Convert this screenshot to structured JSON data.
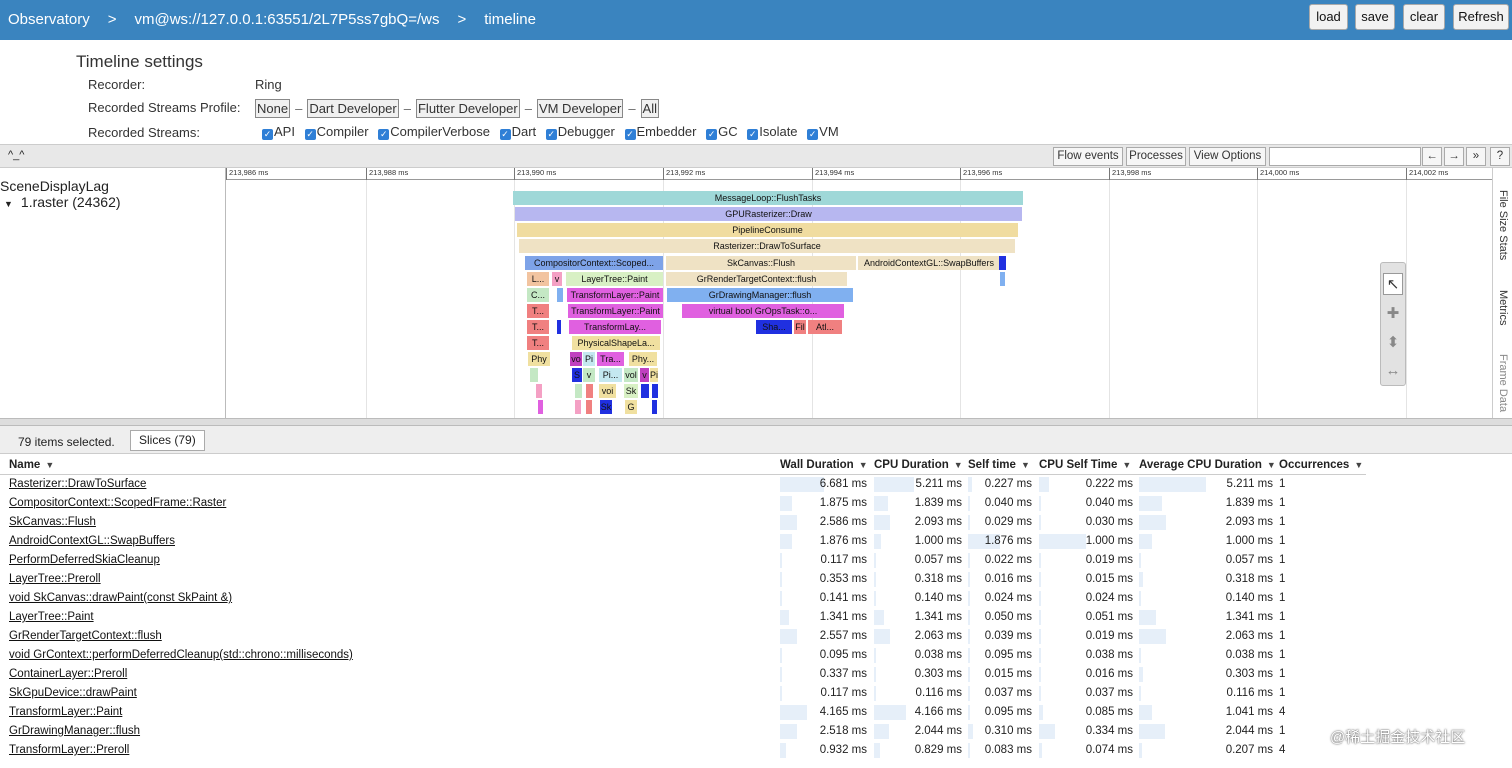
{
  "breadcrumb": [
    "Observatory",
    "vm@ws://127.0.0.1:63551/2L7P5ss7gbQ=/ws",
    "timeline"
  ],
  "breadcrumb_sep": ">",
  "top_buttons": [
    "load",
    "save",
    "clear",
    "Refresh"
  ],
  "settings": {
    "title": "Timeline settings",
    "recorder_label": "Recorder:",
    "recorder_value": "Ring",
    "profile_label": "Recorded Streams Profile:",
    "profiles": [
      "None",
      "Dart Developer",
      "Flutter Developer",
      "VM Developer",
      "All"
    ],
    "profile_sep": "–",
    "streams_label": "Recorded Streams:",
    "streams": [
      "API",
      "Compiler",
      "CompilerVerbose",
      "Dart",
      "Debugger",
      "Embedder",
      "GC",
      "Isolate",
      "VM"
    ],
    "checkmark": "✓"
  },
  "trace_toolbar": {
    "collapse": "^_^",
    "buttons": [
      "Flow events",
      "Processes",
      "View Options"
    ],
    "nav": [
      "←",
      "→",
      "»",
      "?"
    ]
  },
  "track": {
    "process": "SceneDisplayLag",
    "thread": "1.raster (24362)",
    "expand_icon": "▼"
  },
  "ruler_ticks": [
    "213,986 ms",
    "213,988 ms",
    "213,990 ms",
    "213,992 ms",
    "213,994 ms",
    "213,996 ms",
    "213,998 ms",
    "214,000 ms",
    "214,002 ms"
  ],
  "slices": [
    {
      "label": "MessageLoop::FlushTasks",
      "color": "#9fd8d8"
    },
    {
      "label": "GPURasterizer::Draw",
      "color": "#b7b7f0"
    },
    {
      "label": "PipelineConsume",
      "color": "#f0dca0"
    },
    {
      "label": "Rasterizer::DrawToSurface",
      "color": "#efe2c4"
    },
    {
      "label": "CompositorContext::Scoped...",
      "color": "#7ea3e8"
    },
    {
      "label": "SkCanvas::Flush",
      "color": "#efe2c4"
    },
    {
      "label": "AndroidContextGL::SwapBuffers",
      "color": "#efe2c4"
    },
    {
      "label": "L...",
      "color": "#f2c4a0"
    },
    {
      "label": "v",
      "color": "#f4a0c4"
    },
    {
      "label": "LayerTree::Paint",
      "color": "#d8f0c4"
    },
    {
      "label": "GrRenderTargetContext::flush",
      "color": "#efe2c4"
    },
    {
      "label": "C...",
      "color": "#c4e8c4"
    },
    {
      "label": "TransformLayer::Paint",
      "color": "#e060e0"
    },
    {
      "label": "GrDrawingManager::flush",
      "color": "#80b0f0"
    },
    {
      "label": "T...",
      "color": "#f08080"
    },
    {
      "label": "TransformLayer::Paint",
      "color": "#e060e0"
    },
    {
      "label": "virtual bool GrOpsTask::o...",
      "color": "#e060e0"
    },
    {
      "label": "T...",
      "color": "#f08080"
    },
    {
      "label": "TransformLay...",
      "color": "#e060e0"
    },
    {
      "label": "Sha...",
      "color": "#2030e0"
    },
    {
      "label": "Fil",
      "color": "#f08080"
    },
    {
      "label": "Atl...",
      "color": "#f08080"
    },
    {
      "label": "T...",
      "color": "#f08080"
    },
    {
      "label": "PhysicalShapeLa...",
      "color": "#f0e0a0"
    },
    {
      "label": "Phy",
      "color": "#f0e0a0"
    },
    {
      "label": "vo",
      "color": "#c040c0"
    },
    {
      "label": "Pi",
      "color": "#c4e8f0"
    },
    {
      "label": "Tra...",
      "color": "#e060e0"
    },
    {
      "label": "Phy...",
      "color": "#f0e0a0"
    },
    {
      "label": "S",
      "color": "#2030e0"
    },
    {
      "label": "v",
      "color": "#c4e8c4"
    },
    {
      "label": "Pi...",
      "color": "#c4e8f0"
    },
    {
      "label": "vol",
      "color": "#c4e8c4"
    },
    {
      "label": "v",
      "color": "#c040c0"
    },
    {
      "label": "Pi",
      "color": "#f0e0a0"
    },
    {
      "label": "voi",
      "color": "#f0e0a0"
    },
    {
      "label": "Sk",
      "color": "#d8f0c4"
    },
    {
      "label": "Sk",
      "color": "#2030e0"
    },
    {
      "label": "G",
      "color": "#f0e0a0"
    }
  ],
  "side_tabs": [
    "File Size Stats",
    "Metrics",
    "Frame Data"
  ],
  "tools": [
    "↖",
    "✚",
    "⬍",
    "↔"
  ],
  "selection": {
    "count_text": "79 items selected.",
    "tab": "Slices (79)"
  },
  "table": {
    "sort_icon": "▼",
    "columns": [
      "Name",
      "Wall Duration",
      "CPU Duration",
      "Self time",
      "CPU Self Time",
      "Average CPU Duration",
      "Occurrences"
    ],
    "rows": [
      {
        "name": "Rasterizer::DrawToSurface",
        "wall": "6.681 ms",
        "cpu": "5.211 ms",
        "self": "0.227 ms",
        "cpuself": "0.222 ms",
        "avg": "5.211 ms",
        "occ": "1",
        "wall_f": 1.0,
        "cpu_f": 0.9,
        "self_f": 0.12,
        "cpuself_f": 0.22,
        "avg_f": 1.0
      },
      {
        "name": "CompositorContext::ScopedFrame::Raster",
        "wall": "1.875 ms",
        "cpu": "1.839 ms",
        "self": "0.040 ms",
        "cpuself": "0.040 ms",
        "avg": "1.839 ms",
        "occ": "1",
        "wall_f": 0.28,
        "cpu_f": 0.32,
        "self_f": 0.02,
        "cpuself_f": 0.04,
        "avg_f": 0.35
      },
      {
        "name": "SkCanvas::Flush",
        "wall": "2.586 ms",
        "cpu": "2.093 ms",
        "self": "0.029 ms",
        "cpuself": "0.030 ms",
        "avg": "2.093 ms",
        "occ": "1",
        "wall_f": 0.39,
        "cpu_f": 0.36,
        "self_f": 0.02,
        "cpuself_f": 0.03,
        "avg_f": 0.4
      },
      {
        "name": "AndroidContextGL::SwapBuffers",
        "wall": "1.876 ms",
        "cpu": "1.000 ms",
        "self": "1.876 ms",
        "cpuself": "1.000 ms",
        "avg": "1.000 ms",
        "occ": "1",
        "wall_f": 0.28,
        "cpu_f": 0.17,
        "self_f": 1.0,
        "cpuself_f": 1.0,
        "avg_f": 0.19
      },
      {
        "name": "PerformDeferredSkiaCleanup",
        "wall": "0.117 ms",
        "cpu": "0.057 ms",
        "self": "0.022 ms",
        "cpuself": "0.019 ms",
        "avg": "0.057 ms",
        "occ": "1",
        "wall_f": 0.02,
        "cpu_f": 0.01,
        "self_f": 0.01,
        "cpuself_f": 0.02,
        "avg_f": 0.01
      },
      {
        "name": "LayerTree::Preroll",
        "wall": "0.353 ms",
        "cpu": "0.318 ms",
        "self": "0.016 ms",
        "cpuself": "0.015 ms",
        "avg": "0.318 ms",
        "occ": "1",
        "wall_f": 0.05,
        "cpu_f": 0.05,
        "self_f": 0.01,
        "cpuself_f": 0.02,
        "avg_f": 0.06
      },
      {
        "name": "void SkCanvas::drawPaint(const SkPaint &)",
        "wall": "0.141 ms",
        "cpu": "0.140 ms",
        "self": "0.024 ms",
        "cpuself": "0.024 ms",
        "avg": "0.140 ms",
        "occ": "1",
        "wall_f": 0.02,
        "cpu_f": 0.02,
        "self_f": 0.01,
        "cpuself_f": 0.02,
        "avg_f": 0.03
      },
      {
        "name": "LayerTree::Paint",
        "wall": "1.341 ms",
        "cpu": "1.341 ms",
        "self": "0.050 ms",
        "cpuself": "0.051 ms",
        "avg": "1.341 ms",
        "occ": "1",
        "wall_f": 0.2,
        "cpu_f": 0.23,
        "self_f": 0.03,
        "cpuself_f": 0.05,
        "avg_f": 0.26
      },
      {
        "name": "GrRenderTargetContext::flush",
        "wall": "2.557 ms",
        "cpu": "2.063 ms",
        "self": "0.039 ms",
        "cpuself": "0.019 ms",
        "avg": "2.063 ms",
        "occ": "1",
        "wall_f": 0.38,
        "cpu_f": 0.36,
        "self_f": 0.02,
        "cpuself_f": 0.02,
        "avg_f": 0.4
      },
      {
        "name": "void GrContext::performDeferredCleanup(std::chrono::milliseconds)",
        "wall": "0.095 ms",
        "cpu": "0.038 ms",
        "self": "0.095 ms",
        "cpuself": "0.038 ms",
        "avg": "0.038 ms",
        "occ": "1",
        "wall_f": 0.01,
        "cpu_f": 0.01,
        "self_f": 0.05,
        "cpuself_f": 0.04,
        "avg_f": 0.01
      },
      {
        "name": "ContainerLayer::Preroll",
        "wall": "0.337 ms",
        "cpu": "0.303 ms",
        "self": "0.015 ms",
        "cpuself": "0.016 ms",
        "avg": "0.303 ms",
        "occ": "1",
        "wall_f": 0.05,
        "cpu_f": 0.05,
        "self_f": 0.01,
        "cpuself_f": 0.02,
        "avg_f": 0.06
      },
      {
        "name": "SkGpuDevice::drawPaint",
        "wall": "0.117 ms",
        "cpu": "0.116 ms",
        "self": "0.037 ms",
        "cpuself": "0.037 ms",
        "avg": "0.116 ms",
        "occ": "1",
        "wall_f": 0.02,
        "cpu_f": 0.02,
        "self_f": 0.02,
        "cpuself_f": 0.04,
        "avg_f": 0.02
      },
      {
        "name": "TransformLayer::Paint",
        "wall": "4.165 ms",
        "cpu": "4.166 ms",
        "self": "0.095 ms",
        "cpuself": "0.085 ms",
        "avg": "1.041 ms",
        "occ": "4",
        "wall_f": 0.62,
        "cpu_f": 0.72,
        "self_f": 0.05,
        "cpuself_f": 0.09,
        "avg_f": 0.2
      },
      {
        "name": "GrDrawingManager::flush",
        "wall": "2.518 ms",
        "cpu": "2.044 ms",
        "self": "0.310 ms",
        "cpuself": "0.334 ms",
        "avg": "2.044 ms",
        "occ": "1",
        "wall_f": 0.38,
        "cpu_f": 0.35,
        "self_f": 0.17,
        "cpuself_f": 0.33,
        "avg_f": 0.39
      },
      {
        "name": "TransformLayer::Preroll",
        "wall": "0.932 ms",
        "cpu": "0.829 ms",
        "self": "0.083 ms",
        "cpuself": "0.074 ms",
        "avg": "0.207 ms",
        "occ": "4",
        "wall_f": 0.14,
        "cpu_f": 0.14,
        "self_f": 0.04,
        "cpuself_f": 0.07,
        "avg_f": 0.04
      }
    ]
  },
  "watermark": "@稀土掘金技术社区"
}
